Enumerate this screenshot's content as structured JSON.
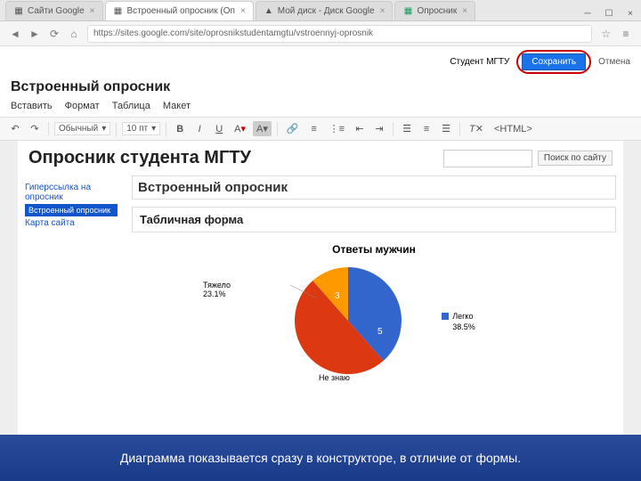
{
  "tabs": [
    {
      "label": "Сайти Google",
      "icon_color": "#4285f4"
    },
    {
      "label": "Встроенный опросник (Оп",
      "icon_color": "#4285f4"
    },
    {
      "label": "Мой диск - Диск Google",
      "icon_color": "#4285f4"
    },
    {
      "label": "Опросник",
      "icon_color": "#0f9d58"
    }
  ],
  "url": "https://sites.google.com/site/oprosnikstudentamgtu/vstroennyj-oprosnik",
  "top_right": {
    "student": "Студент МГТУ",
    "create": "Сохранить",
    "cancel": "Отмена"
  },
  "page_title_app": "Встроенный опросник",
  "menu": [
    "Вставить",
    "Формат",
    "Таблица",
    "Макет"
  ],
  "toolbar": {
    "style": "Обычный",
    "font_size": "10 пт"
  },
  "page_h1": "Опросник студента МГТУ",
  "search_btn": "Поиск по сайту",
  "sidebar": {
    "items": [
      {
        "label": "Гиперссылка на опросник"
      },
      {
        "label": "Встроенный опросник"
      },
      {
        "label": "Карта сайта"
      }
    ]
  },
  "main_heading": "Встроенный опросник",
  "form_section": "Табличная форма",
  "chart_data": {
    "type": "pie",
    "title": "Ответы мужчин",
    "series": [
      {
        "name": "Легко",
        "value": 5,
        "pct": "38.5%",
        "color": "#3366cc"
      },
      {
        "name": "Тяжело",
        "value": 3,
        "pct": "23.1%",
        "color": "#ff9900"
      },
      {
        "name": "Не знаю",
        "value": 5,
        "pct": "38.5%",
        "color": "#dc3912"
      }
    ],
    "labels_on_chart": [
      "3",
      "5"
    ]
  },
  "caption": "Диаграмма показывается сразу в конструкторе, в отличие от формы."
}
